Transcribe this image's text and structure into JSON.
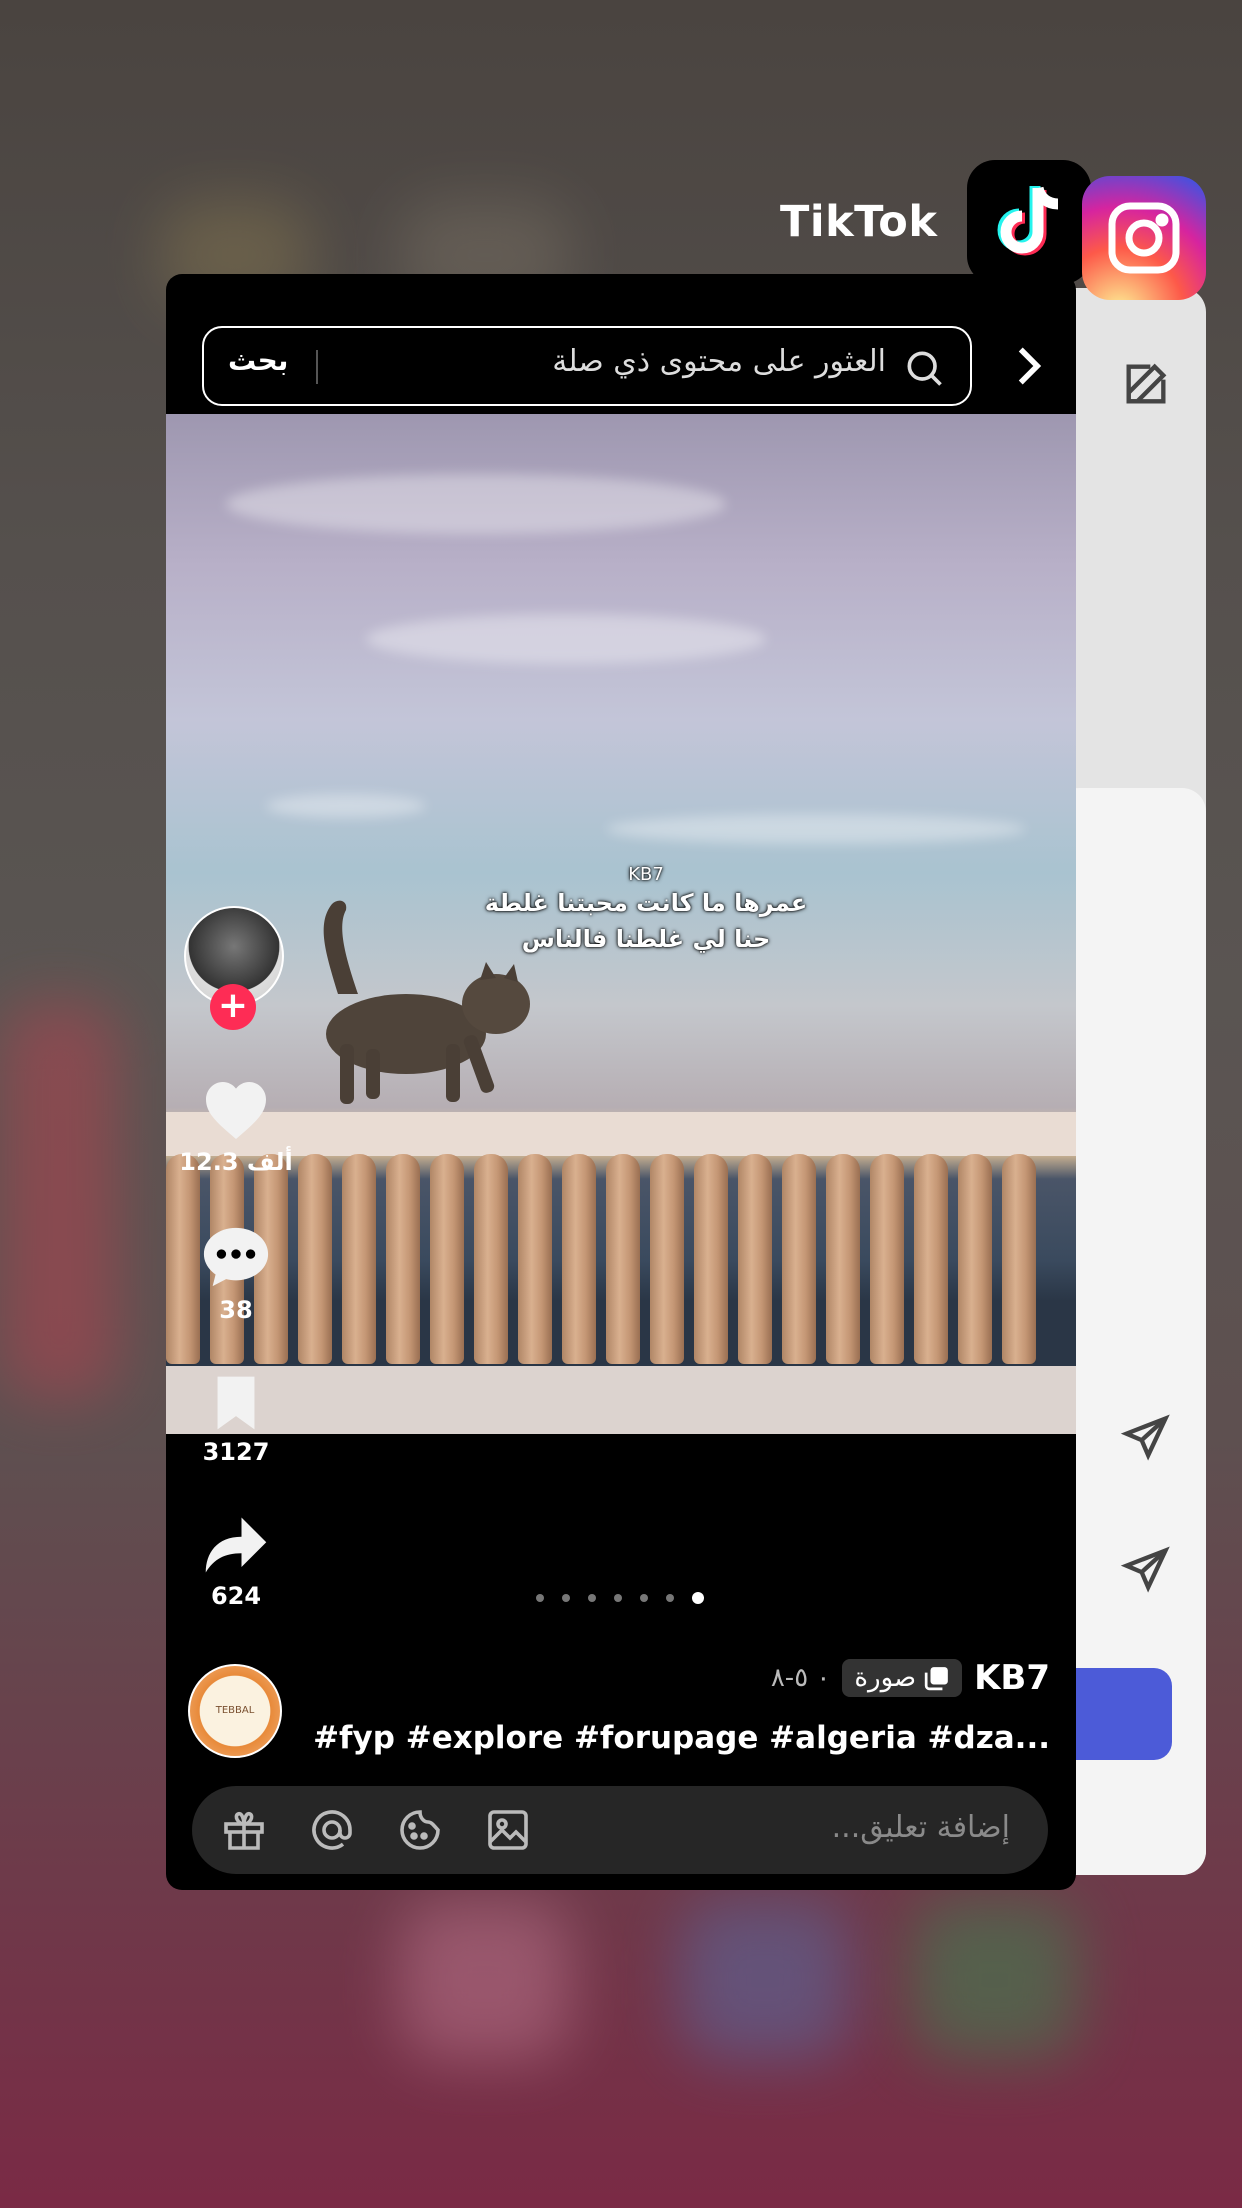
{
  "app_switcher": {
    "app_name": "TikTok",
    "app_icon": "tiktok-logo-icon",
    "neighbor_app_icon": "instagram-logo-icon"
  },
  "search": {
    "button_label": "بحث",
    "placeholder": "العثور على محتوى ذي صلة"
  },
  "post": {
    "overlay_username": "KB7",
    "overlay_line1": "عمرها ما كانت محبتنا غلطة",
    "overlay_line2": "حنا لي غلطنا فالناس",
    "likes": "12.3 ألف",
    "comments": "38",
    "saves": "3127",
    "shares": "624",
    "author": "KB7",
    "type_label": "صورة",
    "date": "٠ ٥-٨",
    "caption": "#fyp #explore #forupage #algeria #dza...",
    "music_avatar_text": "TEBBAL",
    "slides_total": 7,
    "slide_active": 7
  },
  "comment_bar": {
    "placeholder": "إضافة تعليق..."
  },
  "colors": {
    "tiktok_red": "#fe2c55",
    "card_bg": "#000000",
    "instagram_blue_button": "#4c5bd8"
  }
}
